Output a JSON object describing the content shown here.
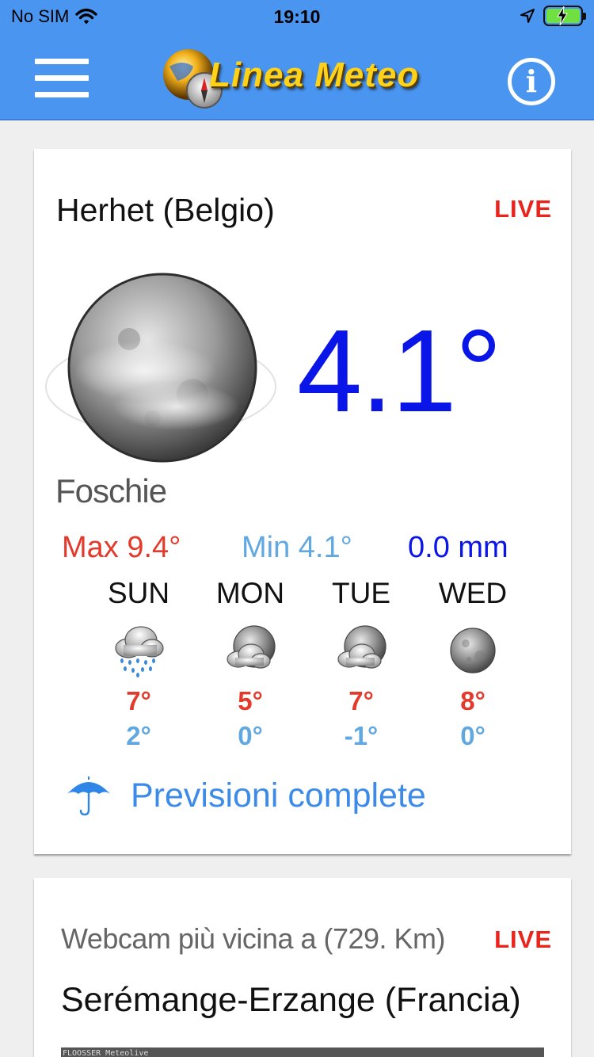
{
  "status_bar": {
    "carrier": "No SIM",
    "time": "19:10"
  },
  "header": {
    "app_name": "Linea Meteo",
    "colors": {
      "bar": "#4a95f0",
      "logo_text": "#ffd21a"
    }
  },
  "current": {
    "location": "Herhet (Belgio)",
    "live_label": "LIVE",
    "temperature": "4.1°",
    "condition": "Foschie",
    "condition_icon": "fog-moon-icon",
    "max": "Max 9.4°",
    "min": "Min 4.1°",
    "precipitation": "0.0 mm"
  },
  "forecast": [
    {
      "day": "SUN",
      "icon": "rain-cloud-icon",
      "max": "7°",
      "min": "2°"
    },
    {
      "day": "MON",
      "icon": "cloudy-moon-icon",
      "max": "5°",
      "min": "0°"
    },
    {
      "day": "TUE",
      "icon": "cloudy-moon-icon",
      "max": "7°",
      "min": "-1°"
    },
    {
      "day": "WED",
      "icon": "moon-icon",
      "max": "8°",
      "min": "0°"
    }
  ],
  "forecast_link": {
    "label": "Previsioni complete",
    "icon": "umbrella-icon"
  },
  "webcam": {
    "label": "Webcam più vicina a (729. Km)",
    "live_label": "LIVE",
    "city": "Serémange-Erzange (Francia)",
    "stamp": "FLOOSSER Meteolive"
  }
}
